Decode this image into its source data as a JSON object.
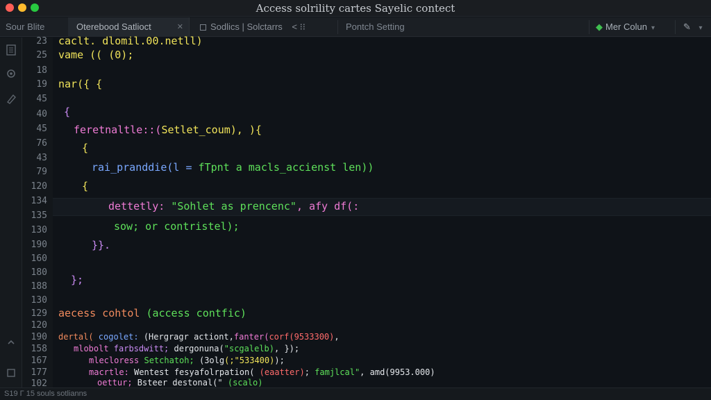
{
  "window": {
    "title": "Access solrility cartes Sayelic contect",
    "traffic_colors": [
      "#ff5f57",
      "#febc2e",
      "#28c840"
    ]
  },
  "tabs": {
    "file_label": "Sour Blite",
    "active_label": "Oterebood Satlioct",
    "active_close": "✕",
    "second_label": "Sodlics | Solctarrs",
    "second_extra": "< ⁝⁝",
    "third_label": "Pontch Setting",
    "right_label": "Mer Colun",
    "right_chevron": "▾",
    "pin_icon": "✎",
    "pin_chevron": "▾"
  },
  "activity_icons": [
    "files-icon",
    "extensions-icon",
    "settings-icon",
    "collapse-icon",
    "manage-icon"
  ],
  "gutter": {
    "line_numbers": [
      "23",
      "25",
      "18",
      "19",
      "45",
      "40",
      "45",
      "76",
      "43",
      "79",
      "120",
      "134",
      "135",
      "130",
      "190",
      "160",
      "180",
      "188",
      "130",
      "129",
      "120",
      "190",
      "158",
      "167",
      "177",
      "102"
    ]
  },
  "code": {
    "l1": "caclt. dlomil.00.netll)",
    "l2": "vame (( (0);",
    "l3": "nar({ {",
    "l4": "{",
    "l5a": "feretnaltle::(",
    "l5b": "Setlet_coum), ){",
    "l6": "{",
    "l7a": "rai_pranddie(l = ",
    "l7b": "fTpnt a macls_accienst len))",
    "l8": "{",
    "l9a": "dettetly: ",
    "l9b": "\"Sohlet as prencenc\"",
    "l9c": ", afy df(:",
    "l10": "sow; or contristel);",
    "l11": "}}.",
    "l12": "};",
    "l13a": "aecess cohtol ",
    "l13b": "(access contfic)",
    "l14a": "dertal( ",
    "l14b": "cogolet: ",
    "l14c": "(Hergragr actiont,",
    "l14d": "fanter(",
    "l14e": "corf(9533300)",
    "l14f": ",",
    "l15a": "mlobolt ",
    "l15b": "farbsdwitt; ",
    "l15c": "dergonuna(",
    "l15d": "\"scgalelb)",
    "l15e": ", });",
    "l16a": "mlecloress ",
    "l16b": "Setchatoh; ",
    "l16c": "(3olg",
    "l16d": "(;\"533400)",
    "l16e": ");",
    "l17a": "macrtle: ",
    "l17b": "Wentest fesyafolrpation( ",
    "l17c": "(eaatter)",
    "l17d": "; ",
    "l17e": "famjlcal\"",
    "l17f": ", amd(9953.000)",
    "l18a": "oettur; ",
    "l18b": "Bsteer destonal(\" ",
    "l18c": "(scalo)"
  },
  "status": {
    "text": "S19 Γ 15 souls sotlianns"
  }
}
